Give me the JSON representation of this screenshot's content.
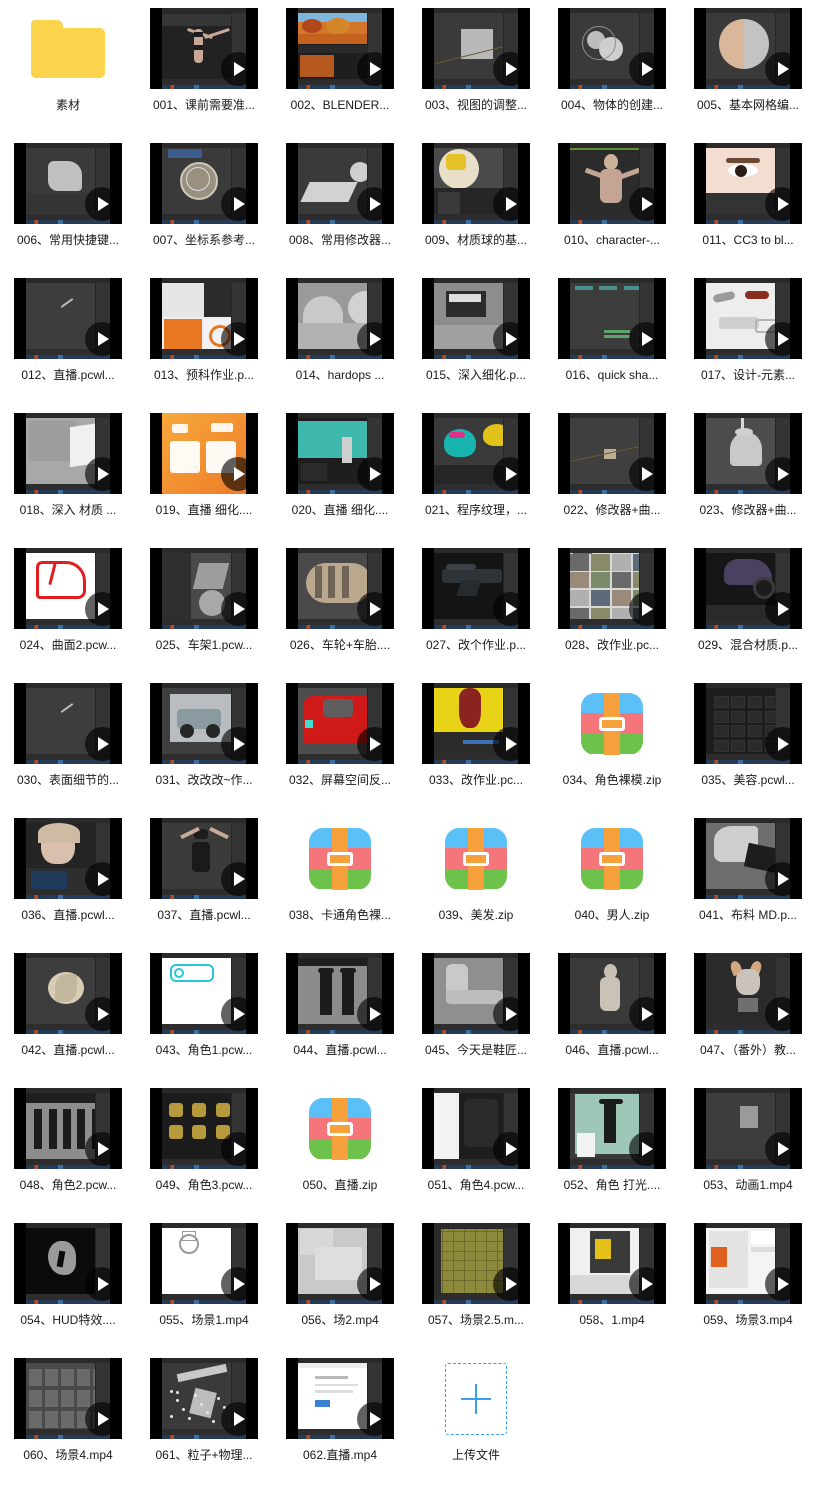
{
  "page": {
    "background": "#ffffff",
    "columns": 6,
    "item_count": 64
  },
  "colors": {
    "folder": "#fcd34d",
    "zip_blue": "#5bc0f8",
    "zip_red": "#f4767a",
    "zip_green": "#6cc24a",
    "zip_orange": "#f6a13c",
    "upload_accent": "#3ba0f0",
    "caption_text": "#1a1a1a",
    "thumb_letterbox": "#000000"
  },
  "icons": {
    "play": "play-icon",
    "folder": "folder-icon",
    "zip": "zip-archive-icon",
    "upload": "plus-icon"
  },
  "items": [
    {
      "label": "素材",
      "kind": "folder"
    },
    {
      "label": "001、课前需要准...",
      "kind": "video",
      "scene": "figure"
    },
    {
      "label": "002、BLENDER...",
      "kind": "video",
      "scene": "autumn"
    },
    {
      "label": "003、视图的调整...",
      "kind": "video",
      "scene": "cube"
    },
    {
      "label": "004、物体的创建...",
      "kind": "video",
      "scene": "spheres"
    },
    {
      "label": "005、基本网格编...",
      "kind": "video",
      "scene": "bigsphere"
    },
    {
      "label": "006、常用快捷键...",
      "kind": "video",
      "scene": "crumple"
    },
    {
      "label": "007、坐标系参考...",
      "kind": "video",
      "scene": "wiresphere"
    },
    {
      "label": "008、常用修改器...",
      "kind": "video",
      "scene": "plane-sphere"
    },
    {
      "label": "009、材质球的基...",
      "kind": "video",
      "scene": "matball"
    },
    {
      "label": "010、character-...",
      "kind": "video",
      "scene": "manbody"
    },
    {
      "label": "011、CC3 to bl...",
      "kind": "video",
      "scene": "eye"
    },
    {
      "label": "012、直播.pcwl...",
      "kind": "video",
      "scene": "empty-dark"
    },
    {
      "label": "013、预科作业.p...",
      "kind": "video",
      "scene": "moodboard"
    },
    {
      "label": "014、hardops ...",
      "kind": "video",
      "scene": "domes"
    },
    {
      "label": "015、深入细化.p...",
      "kind": "video",
      "scene": "hardsurface"
    },
    {
      "label": "016、quick sha...",
      "kind": "video",
      "scene": "nodes"
    },
    {
      "label": "017、设计-元素...",
      "kind": "video",
      "scene": "designwhite"
    },
    {
      "label": "018、深入 材质 ...",
      "kind": "video",
      "scene": "greyplate"
    },
    {
      "label": "019、直播 细化....",
      "kind": "video",
      "scene": "yishu"
    },
    {
      "label": "020、直播 细化....",
      "kind": "video",
      "scene": "teal"
    },
    {
      "label": "021、程序纹理，...",
      "kind": "video",
      "scene": "suzanne"
    },
    {
      "label": "022、修改器+曲...",
      "kind": "video",
      "scene": "tinyobj"
    },
    {
      "label": "023、修改器+曲...",
      "kind": "video",
      "scene": "pagoda"
    },
    {
      "label": "024、曲面2.pcw...",
      "kind": "video",
      "scene": "redsketch"
    },
    {
      "label": "025、车架1.pcw...",
      "kind": "video",
      "scene": "frame"
    },
    {
      "label": "026、车轮+车胎....",
      "kind": "video",
      "scene": "tire"
    },
    {
      "label": "027、改个作业.p...",
      "kind": "video",
      "scene": "gun"
    },
    {
      "label": "028、改作业.pc...",
      "kind": "video",
      "scene": "imagegrid"
    },
    {
      "label": "029、混合材质.p...",
      "kind": "video",
      "scene": "bike"
    },
    {
      "label": "030、表面细节的...",
      "kind": "video",
      "scene": "empty-dark"
    },
    {
      "label": "031、改改改~作...",
      "kind": "video",
      "scene": "motorcycle"
    },
    {
      "label": "032、屏幕空间反...",
      "kind": "video",
      "scene": "redcar"
    },
    {
      "label": "033、改作业.pc...",
      "kind": "video",
      "scene": "yellow"
    },
    {
      "label": "034、角色裸模.zip",
      "kind": "zip"
    },
    {
      "label": "035、美容.pcwl...",
      "kind": "video",
      "scene": "darkgrid"
    },
    {
      "label": "036、直播.pcwl...",
      "kind": "video",
      "scene": "girlface"
    },
    {
      "label": "037、直播.pcwl...",
      "kind": "video",
      "scene": "bodysuit"
    },
    {
      "label": "038、卡通角色裸...",
      "kind": "zip"
    },
    {
      "label": "039、美发.zip",
      "kind": "zip"
    },
    {
      "label": "040、男人.zip",
      "kind": "zip"
    },
    {
      "label": "041、布料 MD.p...",
      "kind": "video",
      "scene": "cloth"
    },
    {
      "label": "042、直播.pcwl...",
      "kind": "video",
      "scene": "shellball"
    },
    {
      "label": "043、角色1.pcw...",
      "kind": "video",
      "scene": "cyansketch"
    },
    {
      "label": "044、直播.pcwl...",
      "kind": "video",
      "scene": "twofigures"
    },
    {
      "label": "045、今天是鞋匠...",
      "kind": "video",
      "scene": "boot"
    },
    {
      "label": "046、直播.pcwl...",
      "kind": "video",
      "scene": "mannequin"
    },
    {
      "label": "047、（番外）教...",
      "kind": "video",
      "scene": "cathead"
    },
    {
      "label": "048、角色2.pcw...",
      "kind": "video",
      "scene": "runway"
    },
    {
      "label": "049、角色3.pcw...",
      "kind": "video",
      "scene": "goldnodes"
    },
    {
      "label": "050、直播.zip",
      "kind": "zip"
    },
    {
      "label": "051、角色4.pcw...",
      "kind": "video",
      "scene": "blackcloth"
    },
    {
      "label": "052、角色 打光....",
      "kind": "video",
      "scene": "greenstudio"
    },
    {
      "label": "053、动画1.mp4",
      "kind": "video",
      "scene": "greysquare"
    },
    {
      "label": "054、HUD特效....",
      "kind": "video",
      "scene": "hud"
    },
    {
      "label": "055、场景1.mp4",
      "kind": "video",
      "scene": "whiteplan"
    },
    {
      "label": "056、场2.mp4",
      "kind": "video",
      "scene": "greyblocks"
    },
    {
      "label": "057、场景2.5.m...",
      "kind": "video",
      "scene": "tiles"
    },
    {
      "label": "058、1.mp4",
      "kind": "video",
      "scene": "yellowbox"
    },
    {
      "label": "059、场景3.mp4",
      "kind": "video",
      "scene": "webpage"
    },
    {
      "label": "060、场景4.mp4",
      "kind": "video",
      "scene": "windowgrid"
    },
    {
      "label": "061、粒子+物理...",
      "kind": "video",
      "scene": "particles"
    },
    {
      "label": "062.直播.mp4",
      "kind": "video",
      "scene": "document"
    },
    {
      "label": "上传文件",
      "kind": "upload"
    }
  ]
}
